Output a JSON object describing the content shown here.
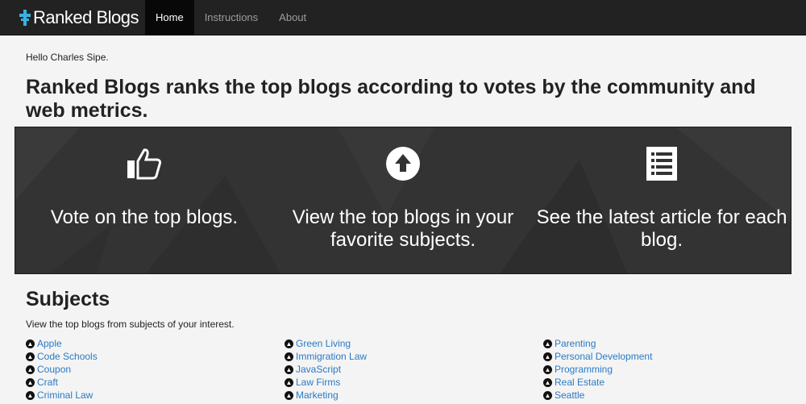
{
  "nav": {
    "brand": "Ranked Blogs",
    "items": [
      "Home",
      "Instructions",
      "About"
    ]
  },
  "greeting": "Hello Charles Sipe.",
  "headline": "Ranked Blogs ranks the top blogs according to votes by the community and web metrics.",
  "features": [
    {
      "icon": "thumbs-up-icon",
      "text": "Vote on the top blogs."
    },
    {
      "icon": "arrow-up-circle-icon",
      "text": "View the top blogs in your favorite subjects."
    },
    {
      "icon": "list-icon",
      "text": "See the latest article for each blog."
    }
  ],
  "subjects": {
    "title": "Subjects",
    "subtitle": "View the top blogs from subjects of your interest.",
    "columns": [
      [
        "Apple",
        "Code Schools",
        "Coupon",
        "Craft",
        "Criminal Law"
      ],
      [
        "Green Living",
        "Immigration Law",
        "JavaScript",
        "Law Firms",
        "Marketing"
      ],
      [
        "Parenting",
        "Personal Development",
        "Programming",
        "Real Estate",
        "Seattle"
      ]
    ]
  }
}
